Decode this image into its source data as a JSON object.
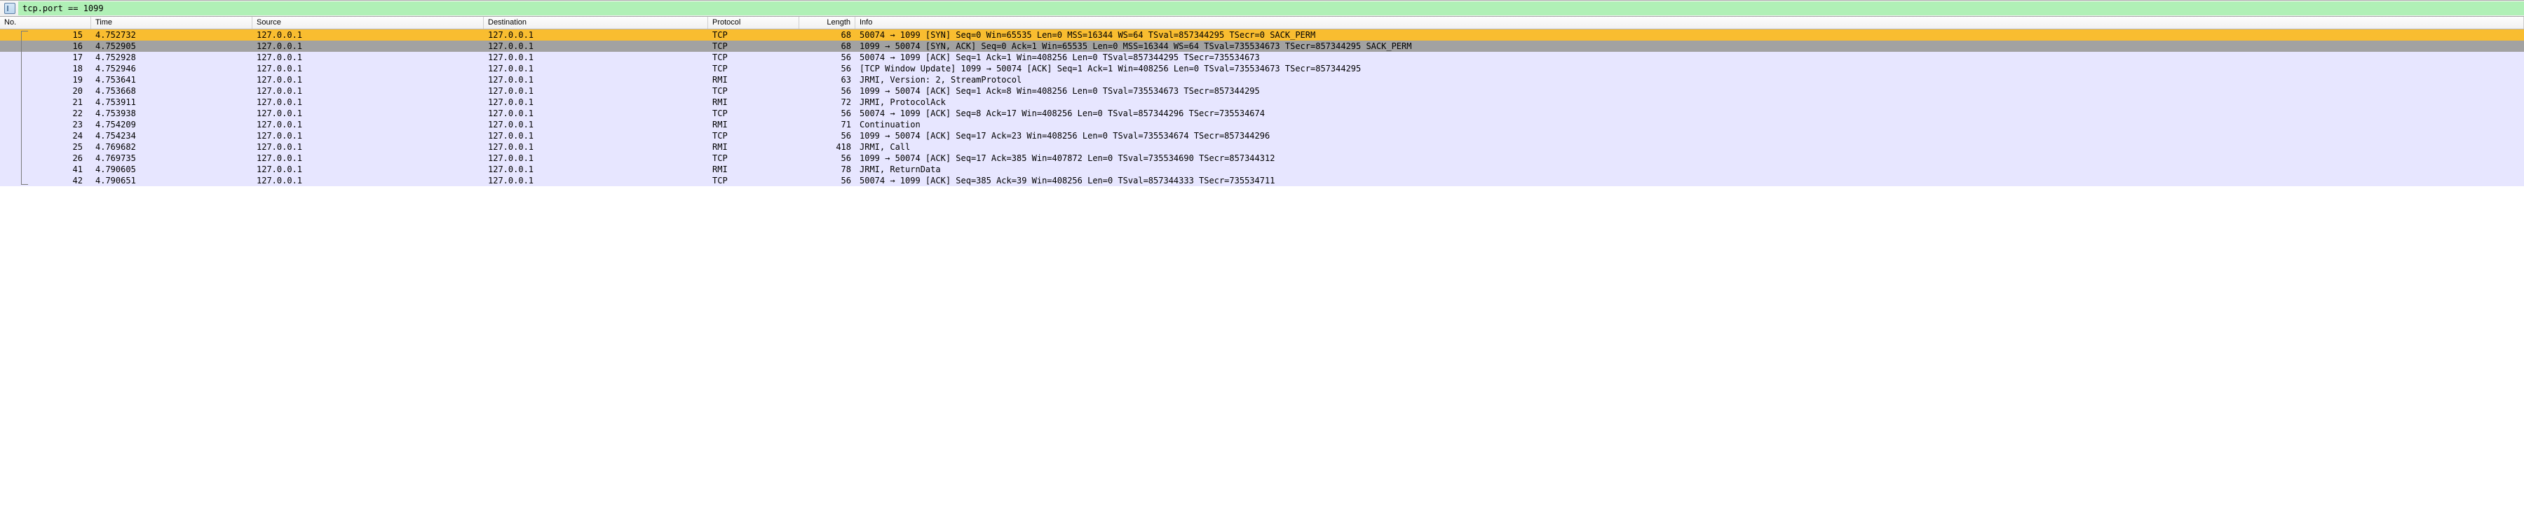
{
  "filter": {
    "expression": "tcp.port == 1099"
  },
  "columns": {
    "no": "No.",
    "time": "Time",
    "source": "Source",
    "destination": "Destination",
    "protocol": "Protocol",
    "length": "Length",
    "info": "Info"
  },
  "arrow_glyph": "→",
  "packets": [
    {
      "no": 15,
      "time": "4.752732",
      "src": "127.0.0.1",
      "dst": "127.0.0.1",
      "proto": "TCP",
      "len": 68,
      "style": "sel",
      "info": "50074 → 1099 [SYN] Seq=0 Win=65535 Len=0 MSS=16344 WS=64 TSval=857344295 TSecr=0 SACK_PERM"
    },
    {
      "no": 16,
      "time": "4.752905",
      "src": "127.0.0.1",
      "dst": "127.0.0.1",
      "proto": "TCP",
      "len": 68,
      "style": "synack",
      "info": "1099 → 50074 [SYN, ACK] Seq=0 Ack=1 Win=65535 Len=0 MSS=16344 WS=64 TSval=735534673 TSecr=857344295 SACK_PERM"
    },
    {
      "no": 17,
      "time": "4.752928",
      "src": "127.0.0.1",
      "dst": "127.0.0.1",
      "proto": "TCP",
      "len": 56,
      "style": "tcp",
      "info": "50074 → 1099 [ACK] Seq=1 Ack=1 Win=408256 Len=0 TSval=857344295 TSecr=735534673"
    },
    {
      "no": 18,
      "time": "4.752946",
      "src": "127.0.0.1",
      "dst": "127.0.0.1",
      "proto": "TCP",
      "len": 56,
      "style": "tcp",
      "info": "[TCP Window Update] 1099 → 50074 [ACK] Seq=1 Ack=1 Win=408256 Len=0 TSval=735534673 TSecr=857344295"
    },
    {
      "no": 19,
      "time": "4.753641",
      "src": "127.0.0.1",
      "dst": "127.0.0.1",
      "proto": "RMI",
      "len": 63,
      "style": "rmi",
      "info": "JRMI, Version: 2, StreamProtocol"
    },
    {
      "no": 20,
      "time": "4.753668",
      "src": "127.0.0.1",
      "dst": "127.0.0.1",
      "proto": "TCP",
      "len": 56,
      "style": "tcp",
      "info": "1099 → 50074 [ACK] Seq=1 Ack=8 Win=408256 Len=0 TSval=735534673 TSecr=857344295"
    },
    {
      "no": 21,
      "time": "4.753911",
      "src": "127.0.0.1",
      "dst": "127.0.0.1",
      "proto": "RMI",
      "len": 72,
      "style": "rmi",
      "info": "JRMI, ProtocolAck"
    },
    {
      "no": 22,
      "time": "4.753938",
      "src": "127.0.0.1",
      "dst": "127.0.0.1",
      "proto": "TCP",
      "len": 56,
      "style": "tcp",
      "info": "50074 → 1099 [ACK] Seq=8 Ack=17 Win=408256 Len=0 TSval=857344296 TSecr=735534674"
    },
    {
      "no": 23,
      "time": "4.754209",
      "src": "127.0.0.1",
      "dst": "127.0.0.1",
      "proto": "RMI",
      "len": 71,
      "style": "rmi",
      "info": "Continuation"
    },
    {
      "no": 24,
      "time": "4.754234",
      "src": "127.0.0.1",
      "dst": "127.0.0.1",
      "proto": "TCP",
      "len": 56,
      "style": "tcp",
      "info": "1099 → 50074 [ACK] Seq=17 Ack=23 Win=408256 Len=0 TSval=735534674 TSecr=857344296"
    },
    {
      "no": 25,
      "time": "4.769682",
      "src": "127.0.0.1",
      "dst": "127.0.0.1",
      "proto": "RMI",
      "len": 418,
      "style": "rmi",
      "info": "JRMI, Call"
    },
    {
      "no": 26,
      "time": "4.769735",
      "src": "127.0.0.1",
      "dst": "127.0.0.1",
      "proto": "TCP",
      "len": 56,
      "style": "tcp",
      "info": "1099 → 50074 [ACK] Seq=17 Ack=385 Win=407872 Len=0 TSval=735534690 TSecr=857344312"
    },
    {
      "no": 41,
      "time": "4.790605",
      "src": "127.0.0.1",
      "dst": "127.0.0.1",
      "proto": "RMI",
      "len": 78,
      "style": "rmi",
      "info": "JRMI, ReturnData"
    },
    {
      "no": 42,
      "time": "4.790651",
      "src": "127.0.0.1",
      "dst": "127.0.0.1",
      "proto": "TCP",
      "len": 56,
      "style": "tcp",
      "info": "50074 → 1099 [ACK] Seq=385 Ack=39 Win=408256 Len=0 TSval=857344333 TSecr=735534711"
    }
  ]
}
